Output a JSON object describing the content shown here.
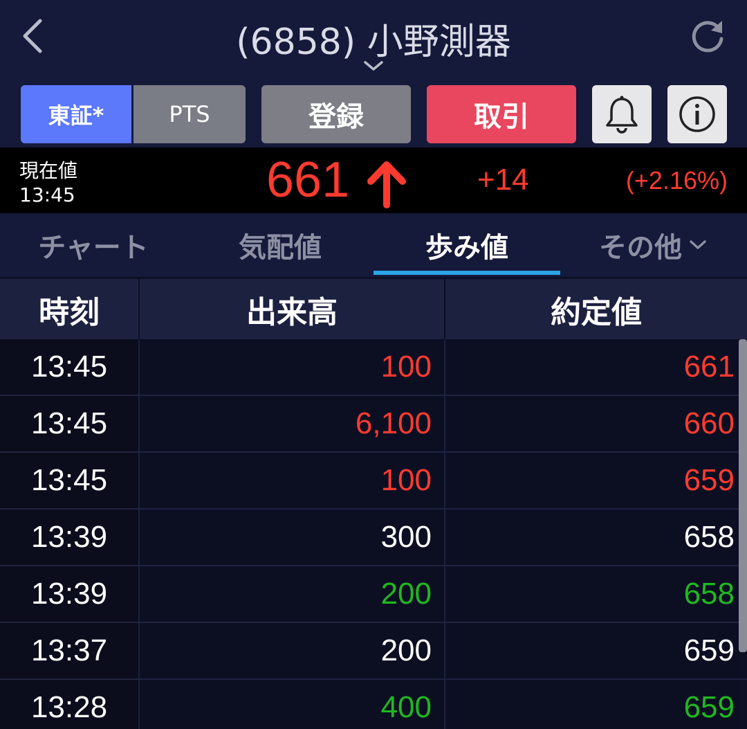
{
  "header": {
    "title": "(6858) 小野測器",
    "icons": {
      "back": "chevron-left-icon",
      "dropdown": "chevron-down-icon",
      "refresh": "refresh-icon"
    }
  },
  "toolbar": {
    "market_tosho": "東証*",
    "market_pts": "PTS",
    "register_label": "登録",
    "trade_label": "取引",
    "icons": {
      "alert": "bell-icon",
      "info": "info-icon"
    }
  },
  "price": {
    "label": "現在値",
    "time": "13:45",
    "current": "661",
    "change": "+14",
    "change_pct": "(+2.16%)",
    "direction_icon": "arrow-up-icon"
  },
  "tabs": [
    {
      "label": "チャート"
    },
    {
      "label": "気配値"
    },
    {
      "label": "歩み値"
    },
    {
      "label": "その他"
    }
  ],
  "active_tab": "歩み値",
  "table": {
    "headers": {
      "time": "時刻",
      "volume": "出来高",
      "price": "約定値"
    },
    "rows": [
      {
        "time": "13:45",
        "volume": "100",
        "price": "661",
        "direction": "up"
      },
      {
        "time": "13:45",
        "volume": "6,100",
        "price": "660",
        "direction": "up"
      },
      {
        "time": "13:45",
        "volume": "100",
        "price": "659",
        "direction": "up"
      },
      {
        "time": "13:39",
        "volume": "300",
        "price": "658",
        "direction": "flat"
      },
      {
        "time": "13:39",
        "volume": "200",
        "price": "658",
        "direction": "down"
      },
      {
        "time": "13:37",
        "volume": "200",
        "price": "659",
        "direction": "flat"
      },
      {
        "time": "13:28",
        "volume": "400",
        "price": "659",
        "direction": "down"
      }
    ]
  },
  "colors": {
    "up": "#ff3b30",
    "down": "#1fb81f",
    "flat": "#ffffff",
    "accent_blue": "#5c78fb",
    "trade_red": "#e8475f",
    "tab_underline": "#2aa5e8"
  }
}
